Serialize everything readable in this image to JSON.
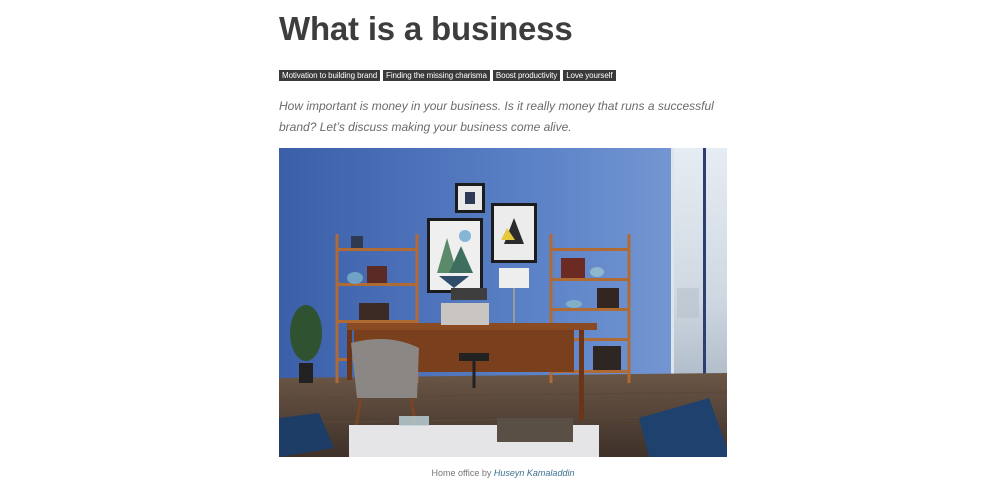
{
  "article": {
    "title": "What is a business",
    "tags": [
      "Motivation to building brand",
      "Finding the missing charisma",
      "Boost productivity",
      "Love yourself"
    ],
    "lead": "How important is money in your business. Is it really money that runs a successful brand? Let’s discuss making your business come alive.",
    "image": {
      "alt": "Home office",
      "caption_prefix": "Home office by",
      "caption_author": "Huseyn Kamaladdin"
    }
  },
  "colors": {
    "wall": "#4f72b8",
    "tag_bg": "#3a3a3a",
    "link": "#3a6f8f"
  }
}
